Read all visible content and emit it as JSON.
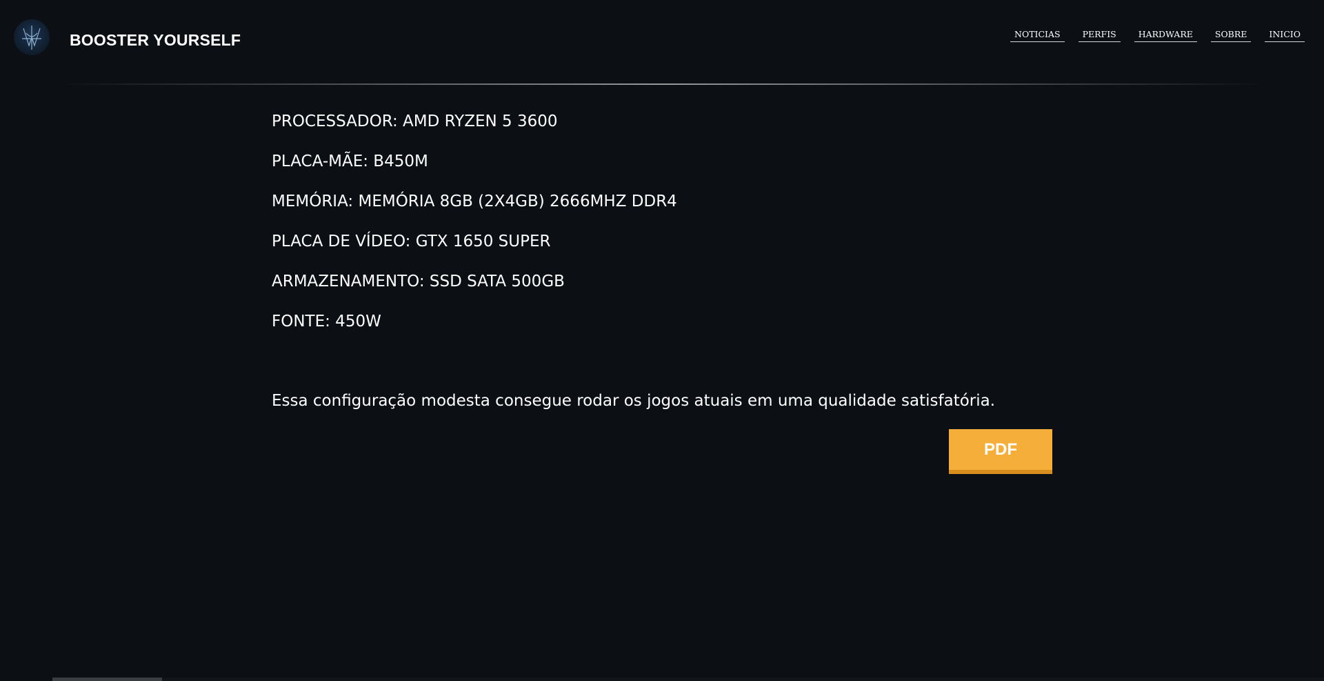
{
  "header": {
    "brand": "BOOSTER YOURSELF",
    "nav": [
      {
        "label": "NOTICIAS"
      },
      {
        "label": "PERFIS"
      },
      {
        "label": "HARDWARE"
      },
      {
        "label": "SOBRE"
      },
      {
        "label": "INICIO"
      }
    ]
  },
  "specs": [
    "PROCESSADOR: AMD RYZEN 5 3600",
    "PLACA-MÃE: B450M",
    "MEMÓRIA: MEMÓRIA 8GB (2X4GB) 2666MHZ DDR4",
    "PLACA DE VÍDEO: GTX 1650 SUPER",
    "ARMAZENAMENTO: SSD SATA 500GB",
    "FONTE: 450W"
  ],
  "description": "Essa configuração modesta consegue rodar os jogos atuais em uma qualidade satisfatória.",
  "pdf_button": {
    "label": "PDF"
  },
  "colors": {
    "background": "#0c0f14",
    "accent": "#f6ae3a",
    "accent_shadow": "#d98f1d",
    "text": "#ffffff"
  },
  "icons": {
    "logo": "brand-logo-icon"
  }
}
